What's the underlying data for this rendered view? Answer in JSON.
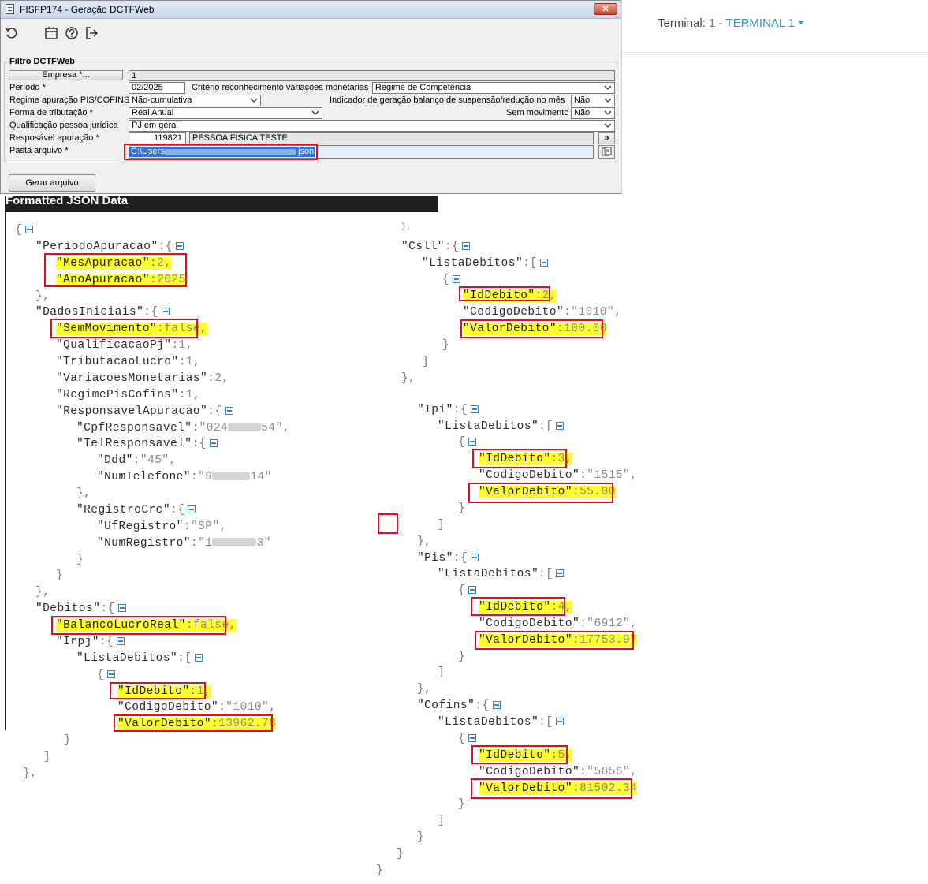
{
  "window": {
    "title": "FISFP174 - Geração DCTFWeb",
    "close": "✕",
    "toolbar_icons": [
      "refresh-icon",
      "calendar-icon",
      "help-icon",
      "exit-icon"
    ]
  },
  "filter": {
    "legend": "Filtro DCTFWeb",
    "empresa_button": "Empresa *...",
    "empresa_value": "1",
    "periodo_label": "Período *",
    "periodo_value": "02/2025",
    "criterio_label": "Critério reconhecimento variações monetárias",
    "criterio_value": "Regime de Competência",
    "regime_label": "Regime apuração PIS/COFINS",
    "regime_value": "Não-cumulativa",
    "indicador_label": "Indicador de geração balanço de suspensão/redução no mês",
    "indicador_value": "Não",
    "forma_label": "Forma de tributação *",
    "forma_value": "Real Anual",
    "sem_mov_label": "Sem movimento",
    "sem_mov_value": "Não",
    "qualificacao_label": "Qualificação pessoa jurídica",
    "qualificacao_value": "PJ em geral",
    "responsavel_label": "Resposável apuração *",
    "responsavel_code": "119821",
    "responsavel_name": "PESSOA FISICA TESTE",
    "responsavel_more": "»",
    "pasta_label": "Pasta arquivo *",
    "pasta_prefix": "C:\\Users",
    "pasta_suffix": "json",
    "gerar_button": "Gerar arquivo"
  },
  "terminal": {
    "label": "Terminal: ",
    "value": "1 - TERMINAL 1"
  },
  "json_viewer": {
    "title": "Formatted JSON Data",
    "periodo": {
      "key": "PeriodoApuracao",
      "mes": "2",
      "ano": "2025"
    },
    "dados": {
      "key": "DadosIniciais",
      "sem_movimento": "false",
      "qualificacao_pj": "1",
      "tributacao_lucro": "1",
      "variacoes_monetarias": "2",
      "regime_pis_cofins": "1",
      "cpf_prefix": "024",
      "cpf_suffix": "54",
      "ddd": "45",
      "tel_prefix": "9",
      "tel_suffix": "14",
      "uf_registro": "SP",
      "num_registro_prefix": "1",
      "num_registro_suffix": "3"
    },
    "debitos": {
      "balanco_lucro_real": "false",
      "irpj": {
        "id": "1",
        "codigo": "1010",
        "valor": "13962.78"
      },
      "csll": {
        "id": "2",
        "codigo": "1010",
        "valor": "100.00"
      },
      "ipi": {
        "id": "3",
        "codigo": "1515",
        "valor": "55.00"
      },
      "pis": {
        "id": "4",
        "codigo": "6912",
        "valor": "17753.97"
      },
      "cofins": {
        "id": "5",
        "codigo": "5856",
        "valor": "81502.34"
      }
    }
  },
  "colors": {
    "highlight": "#ffff2e",
    "annotation_red": "#e0101a",
    "selection_blue": "#3470d6",
    "link_blue": "#3a8fc8"
  }
}
